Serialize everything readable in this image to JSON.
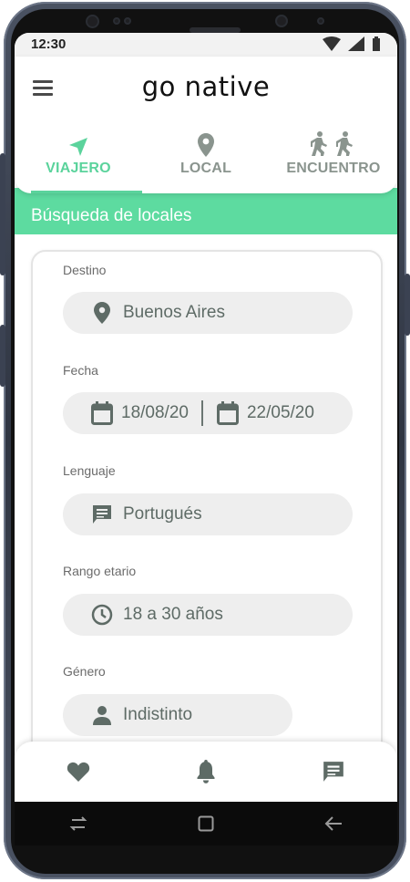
{
  "status_bar": {
    "time": "12:30"
  },
  "app": {
    "name": "go native"
  },
  "tabs": [
    {
      "label": "VIAJERO",
      "icon": "navigation-arrow-icon",
      "active": true
    },
    {
      "label": "LOCAL",
      "icon": "location-pin-icon",
      "active": false
    },
    {
      "label": "ENCUENTRO",
      "icon": "people-walking-icon",
      "active": false
    }
  ],
  "section": {
    "title": "Búsqueda de locales"
  },
  "form": {
    "destino": {
      "label": "Destino",
      "value": "Buenos Aires",
      "icon": "location-pin-icon"
    },
    "fecha": {
      "label": "Fecha",
      "from": "18/08/20",
      "to": "22/05/20",
      "icon": "calendar-icon"
    },
    "lenguaje": {
      "label": "Lenguaje",
      "value": "Portugués",
      "icon": "message-icon"
    },
    "rango": {
      "label": "Rango etario",
      "value": "18 a 30 años",
      "icon": "clock-icon"
    },
    "genero": {
      "label": "Género",
      "value": "Indistinto",
      "icon": "person-icon"
    }
  },
  "bottom_nav": [
    {
      "icon": "heart-icon"
    },
    {
      "icon": "bell-icon"
    },
    {
      "icon": "chat-icon"
    }
  ],
  "colors": {
    "accent": "#5bd39c",
    "section_bar": "#5ddba0",
    "icon": "#5e6b66",
    "pill": "#eeeeee"
  }
}
